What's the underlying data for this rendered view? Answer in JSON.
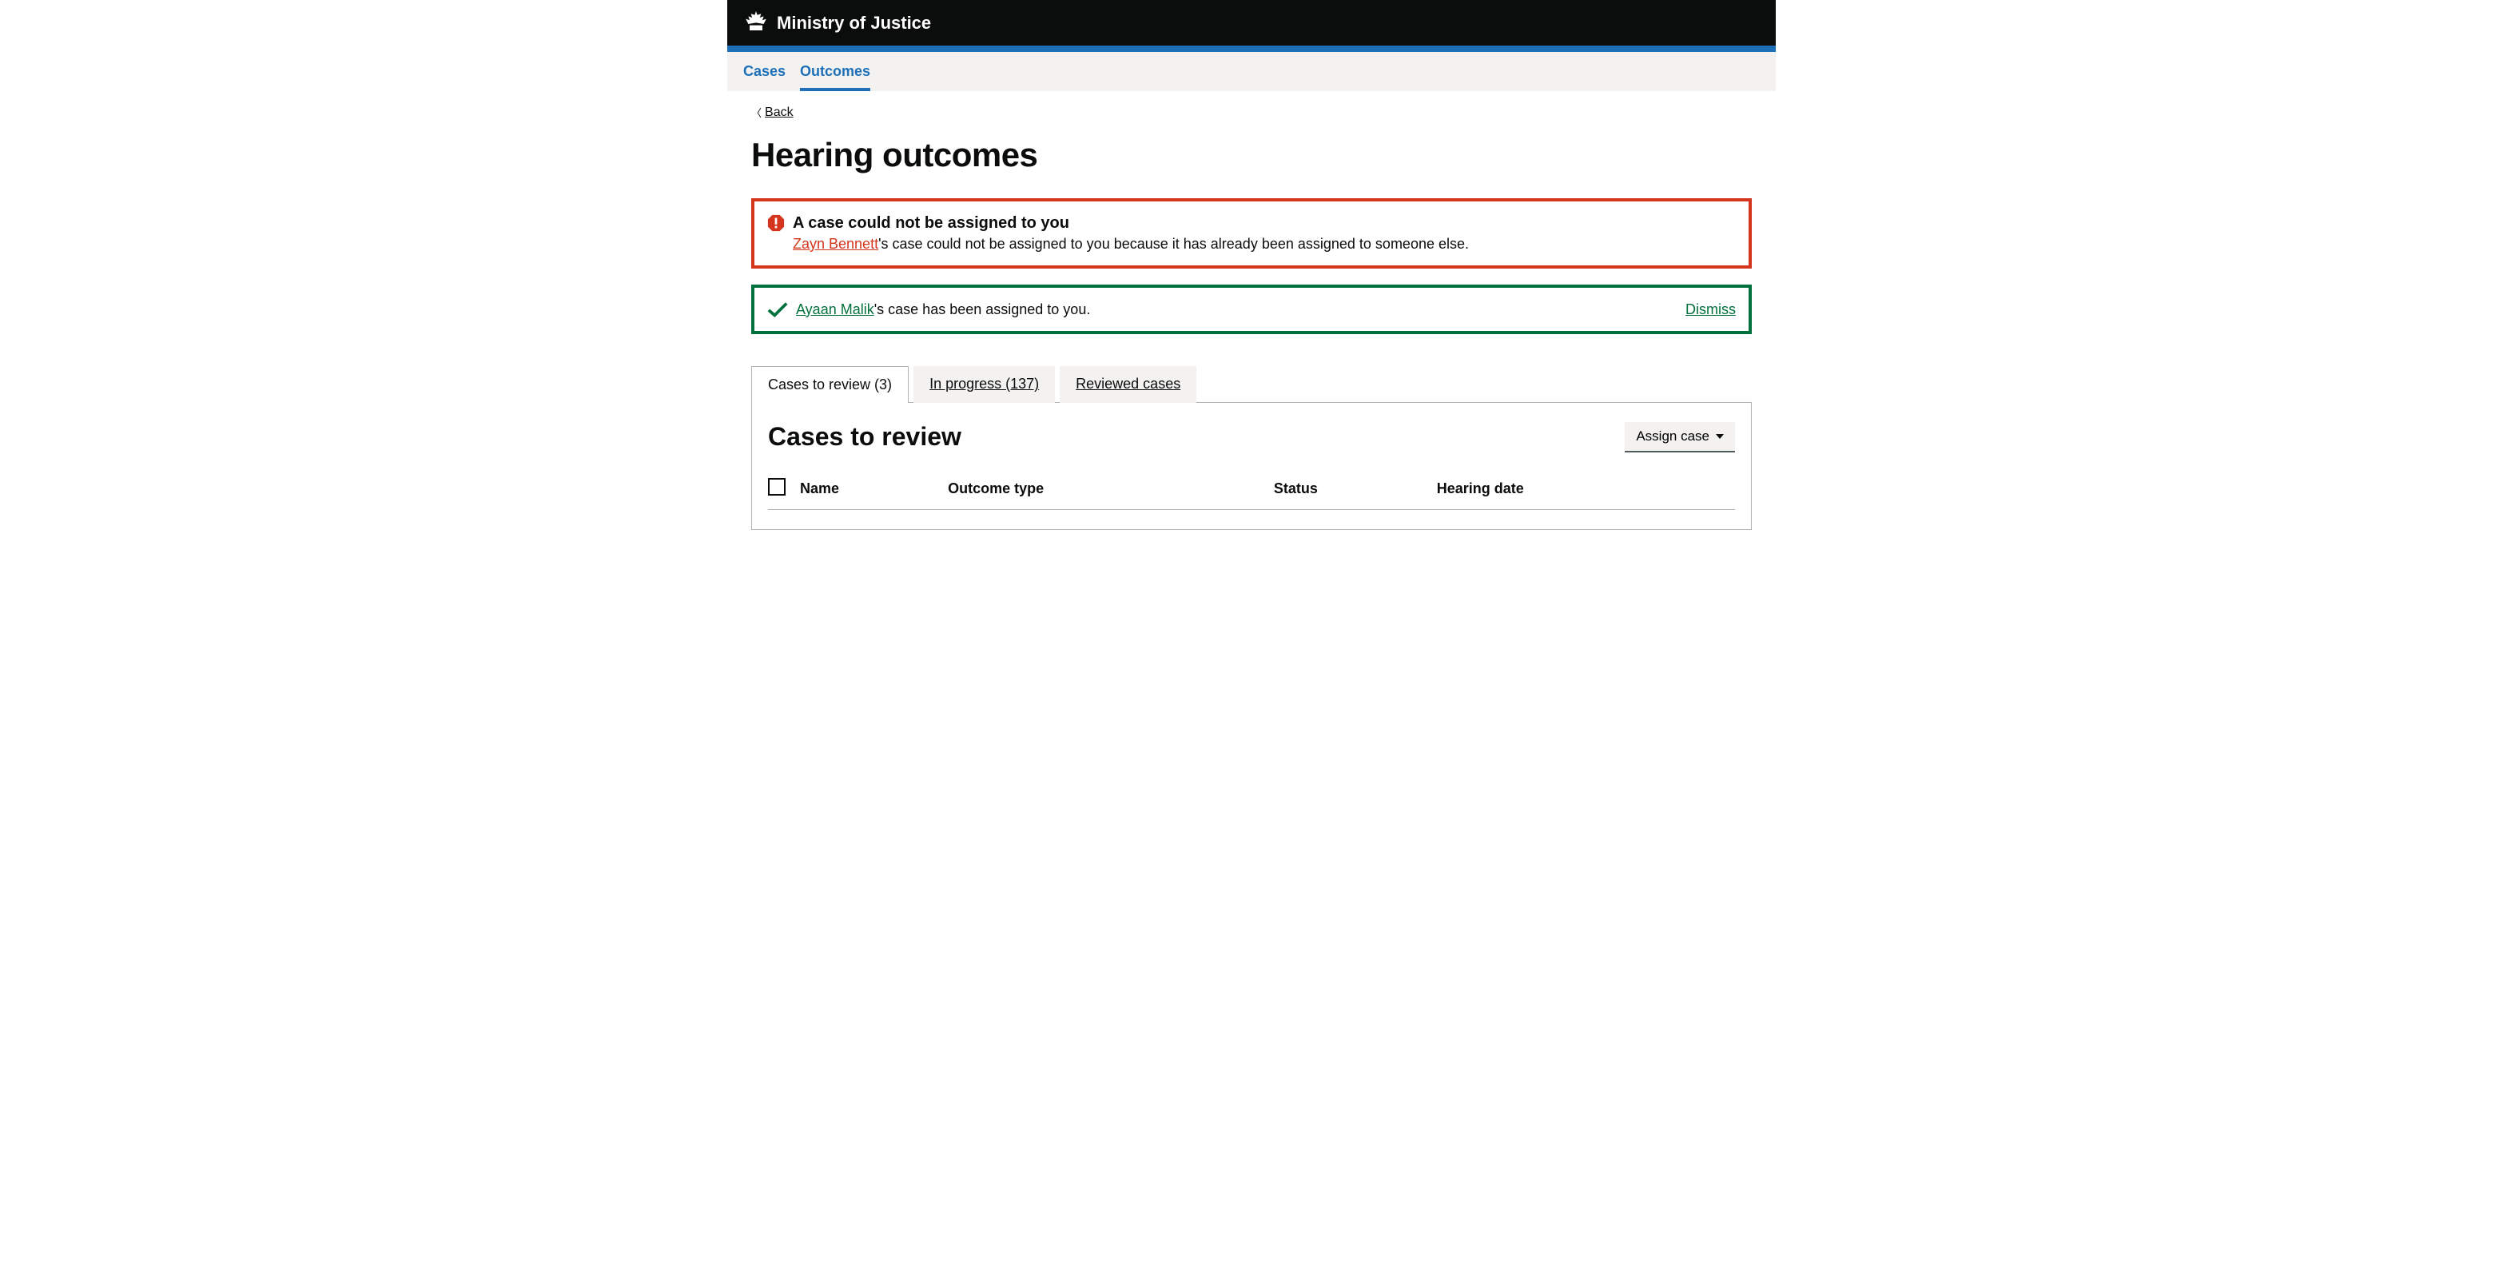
{
  "header": {
    "org_name": "Ministry of Justice"
  },
  "nav": {
    "items": [
      {
        "label": "Cases",
        "active": false
      },
      {
        "label": "Outcomes",
        "active": true
      }
    ]
  },
  "back_link": "Back",
  "page_title": "Hearing outcomes",
  "error_banner": {
    "title": "A case could not be assigned to you",
    "link_name": "Zayn Bennett",
    "message_suffix": "'s case could not be assigned to you because it has already been assigned to someone else."
  },
  "success_banner": {
    "link_name": "Ayaan Malik",
    "message_suffix": "'s case has been assigned to you.",
    "dismiss_label": "Dismiss"
  },
  "tabs": [
    {
      "label": "Cases to review (3)",
      "active": true
    },
    {
      "label": "In progress (137)",
      "active": false
    },
    {
      "label": "Reviewed cases",
      "active": false
    }
  ],
  "panel": {
    "title": "Cases to review",
    "assign_button": "Assign case",
    "columns": [
      "Name",
      "Outcome type",
      "Status",
      "Hearing date"
    ]
  }
}
